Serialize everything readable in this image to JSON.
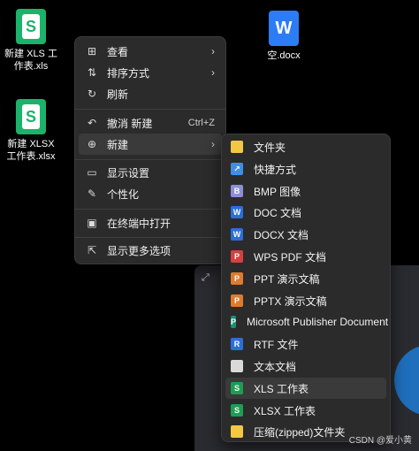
{
  "desktop": {
    "icons": [
      {
        "label_line1": "新建 XLS 工",
        "label_line2": "作表.xls",
        "icon": "xls-file-icon",
        "letter": "S"
      },
      {
        "label_line1": "新建 XLSX",
        "label_line2": "工作表.xlsx",
        "icon": "xlsx-file-icon",
        "letter": "S"
      },
      {
        "label_line1": "空.docx",
        "label_line2": "",
        "icon": "word-file-icon",
        "letter": "W"
      }
    ]
  },
  "context_menu": {
    "items": [
      {
        "label": "查看",
        "icon": "grid-icon",
        "glyph": "⊞",
        "has_submenu": true
      },
      {
        "label": "排序方式",
        "icon": "sort-icon",
        "glyph": "⇅",
        "has_submenu": true
      },
      {
        "label": "刷新",
        "icon": "refresh-icon",
        "glyph": "↻"
      },
      {
        "label": "撤消 新建",
        "icon": "undo-icon",
        "glyph": "↶",
        "shortcut": "Ctrl+Z"
      },
      {
        "label": "新建",
        "icon": "new-icon",
        "glyph": "⊕",
        "has_submenu": true
      },
      {
        "label": "显示设置",
        "icon": "display-settings-icon",
        "glyph": "▭"
      },
      {
        "label": "个性化",
        "icon": "brush-icon",
        "glyph": "✎"
      },
      {
        "label": "在终端中打开",
        "icon": "terminal-icon",
        "glyph": "▣"
      },
      {
        "label": "显示更多选项",
        "icon": "more-options-icon",
        "glyph": "⇱"
      }
    ],
    "arrow_glyph": "›"
  },
  "submenu": {
    "items": [
      {
        "label": "文件夹",
        "icon": "folder-icon",
        "color": "#f2c744",
        "glyph": ""
      },
      {
        "label": "快捷方式",
        "icon": "shortcut-icon",
        "color": "#3f8fe8",
        "glyph": "↗"
      },
      {
        "label": "BMP 图像",
        "icon": "bmp-icon",
        "color": "#8a8fd6",
        "glyph": "B"
      },
      {
        "label": "DOC 文档",
        "icon": "doc-icon",
        "color": "#2c6fd6",
        "glyph": "W"
      },
      {
        "label": "DOCX 文档",
        "icon": "docx-icon",
        "color": "#2c6fd6",
        "glyph": "W"
      },
      {
        "label": "WPS PDF 文档",
        "icon": "pdf-icon",
        "color": "#d64040",
        "glyph": "P"
      },
      {
        "label": "PPT 演示文稿",
        "icon": "ppt-icon",
        "color": "#e07a2c",
        "glyph": "P"
      },
      {
        "label": "PPTX 演示文稿",
        "icon": "pptx-icon",
        "color": "#e07a2c",
        "glyph": "P"
      },
      {
        "label": "Microsoft Publisher Document",
        "icon": "publisher-icon",
        "color": "#1a8f7a",
        "glyph": "P"
      },
      {
        "label": "RTF 文件",
        "icon": "rtf-icon",
        "color": "#2c6fd6",
        "glyph": "R"
      },
      {
        "label": "文本文档",
        "icon": "text-document-icon",
        "color": "#d9d9d9",
        "glyph": ""
      },
      {
        "label": "XLS 工作表",
        "icon": "xls-icon",
        "color": "#1f9d55",
        "glyph": "S"
      },
      {
        "label": "XLSX 工作表",
        "icon": "xlsx-icon",
        "color": "#1f9d55",
        "glyph": "S"
      },
      {
        "label": "压缩(zipped)文件夹",
        "icon": "zip-folder-icon",
        "color": "#f2c744",
        "glyph": ""
      }
    ]
  },
  "background_window": {
    "expand_glyph": "⤢"
  },
  "watermark": "CSDN @爱小黄"
}
